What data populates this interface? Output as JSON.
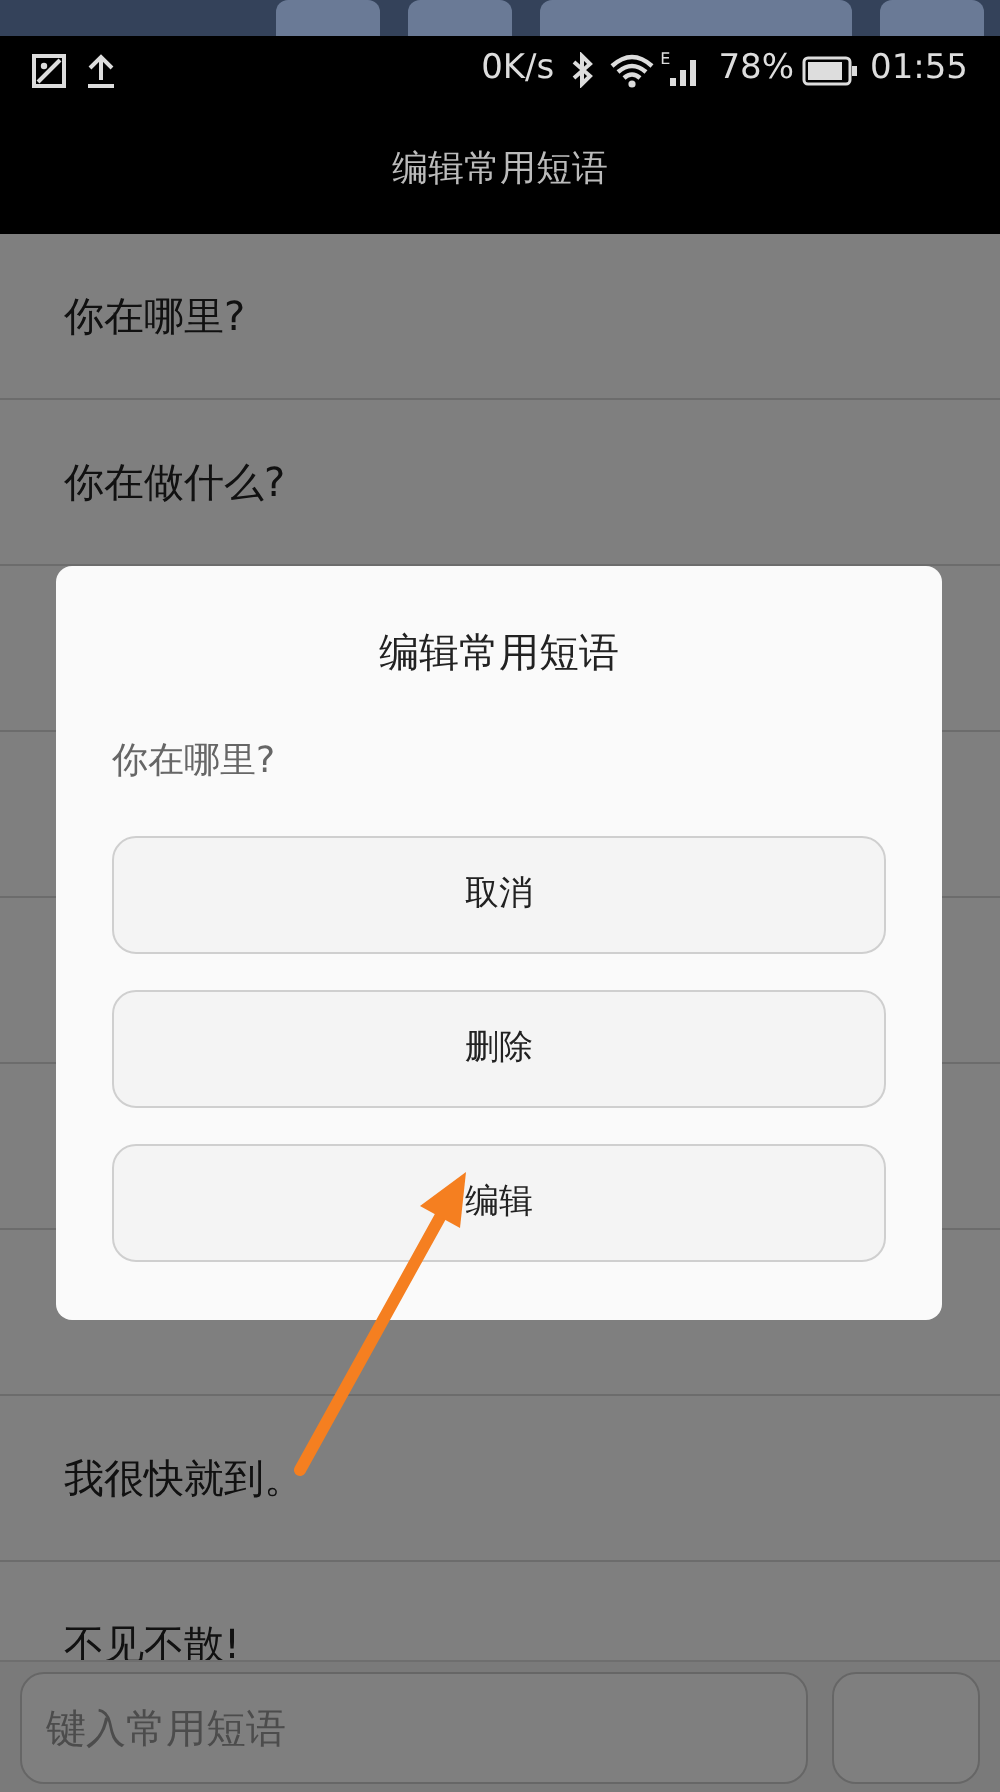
{
  "status_bar": {
    "speed": "0K/s",
    "network": "E",
    "battery": "78%",
    "time": "01:55"
  },
  "title_bar": {
    "title": "编辑常用短语"
  },
  "list_top": [
    {
      "text": "你在哪里?"
    },
    {
      "text": "你在做什么?"
    }
  ],
  "list_bottom": [
    {
      "text": "我很快就到。"
    },
    {
      "text": "不见不散!"
    }
  ],
  "input_bar": {
    "placeholder": "键入常用短语"
  },
  "dialog": {
    "title": "编辑常用短语",
    "message": "你在哪里?",
    "buttons": [
      {
        "label": "取消"
      },
      {
        "label": "删除"
      },
      {
        "label": "编辑"
      }
    ]
  },
  "annotation": {
    "kind": "arrow"
  }
}
